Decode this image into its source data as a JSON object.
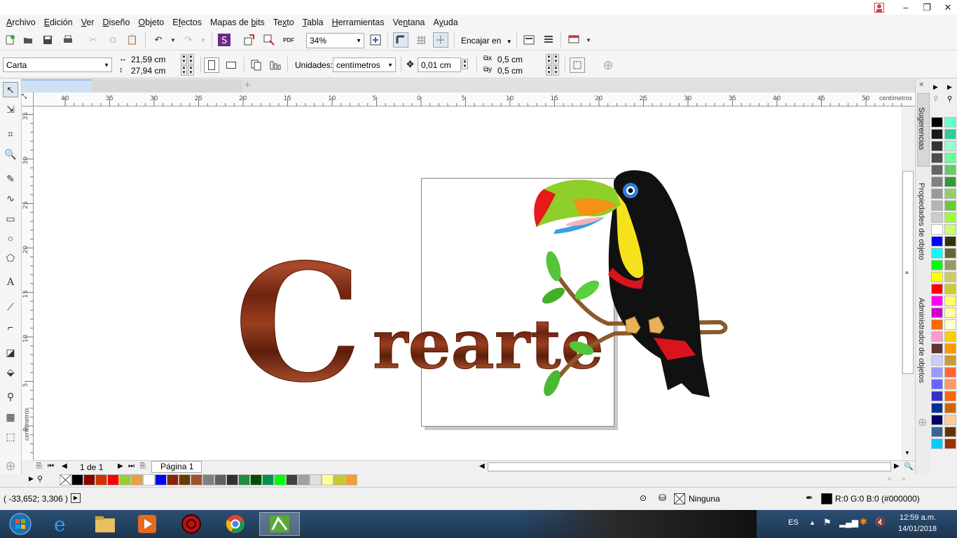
{
  "menu": [
    "Archivo",
    "Edición",
    "Ver",
    "Diseño",
    "Objeto",
    "Efectos",
    "Mapas de bits",
    "Texto",
    "Tabla",
    "Herramientas",
    "Ventana",
    "Ayuda"
  ],
  "menu_underline": [
    "A",
    "E",
    "V",
    "D",
    "O",
    "f",
    "b",
    "x",
    "T",
    "H",
    "n",
    "y"
  ],
  "toolbar": {
    "zoom_value": "34%",
    "snap_label": "Encajar en"
  },
  "property_bar": {
    "page_preset": "Carta",
    "page_width": "21,59 cm",
    "page_height": "27,94 cm",
    "units_label": "Unidades:",
    "units_value": "centímetros",
    "nudge": "0,01 cm",
    "dup_x": "0,5 cm",
    "dup_y": "0,5 cm"
  },
  "ruler": {
    "h_ticks": [
      "40",
      "35",
      "30",
      "25",
      "20",
      "15",
      "10",
      "5",
      "0",
      "5",
      "10",
      "15",
      "20",
      "25",
      "30",
      "35",
      "40",
      "45",
      "50"
    ],
    "h_unit": "centímetros",
    "v_ticks": [
      "35",
      "30",
      "25",
      "20",
      "15",
      "10",
      "5",
      "0"
    ],
    "v_unit": "centímetros"
  },
  "canvas": {
    "artwork_text": "Crearte"
  },
  "dockers": [
    "Sugerencias",
    "Propiedades de objeto",
    "Administrador de objetos"
  ],
  "page_nav": {
    "page_count": "1 de 1",
    "page_tab": "Página 1"
  },
  "status": {
    "coords": "( -33,652; 3,306 )",
    "fill_label": "Ninguna",
    "outline_color": "R:0 G:0 B:0 (#000000)",
    "outline_hex": "#000000"
  },
  "tray": {
    "lang": "ES",
    "time": "12:59 a.m.",
    "date": "14/01/2018"
  },
  "palette_h": [
    "#000000",
    "#8b0000",
    "#cc3300",
    "#ff0000",
    "#9acd32",
    "#e8a040",
    "#ffffff",
    "#0000ff",
    "#8b2500",
    "#6b3a00",
    "#a0522d",
    "#808080",
    "#606060",
    "#303030",
    "#1e8f3c",
    "#005000",
    "#009050",
    "#00ff00",
    "#404040",
    "#a0a0a0",
    "#e0e0e0",
    "#ffff99",
    "#c8c832",
    "#f0a030"
  ],
  "palette_v1": [
    "#000000",
    "#1a1a1a",
    "#333333",
    "#4d4d4d",
    "#666666",
    "#808080",
    "#999999",
    "#b3b3b3",
    "#cccccc",
    "#ffffff",
    "#0000ff",
    "#00ffff",
    "#00ff00",
    "#ffff00",
    "#ff0000",
    "#ff00ff",
    "#cc00cc",
    "#ff6600",
    "#ff99cc",
    "#663333",
    "#ccccff",
    "#9999ff",
    "#6666ff",
    "#3333cc",
    "#003399",
    "#000066",
    "#336699",
    "#00ccff"
  ],
  "palette_v2": [
    "#66ffcc",
    "#33cc99",
    "#99ffcc",
    "#66ff99",
    "#66cc66",
    "#339933",
    "#99cc66",
    "#66cc33",
    "#99ff33",
    "#ccff66",
    "#333300",
    "#666633",
    "#999966",
    "#cccc66",
    "#cccc33",
    "#ffff66",
    "#ffff99",
    "#ffffcc",
    "#ffcc00",
    "#ff9900",
    "#cc9933",
    "#ff6633",
    "#ff9966",
    "#ff6600",
    "#cc6600",
    "#ffcc99",
    "#663300",
    "#993300"
  ]
}
